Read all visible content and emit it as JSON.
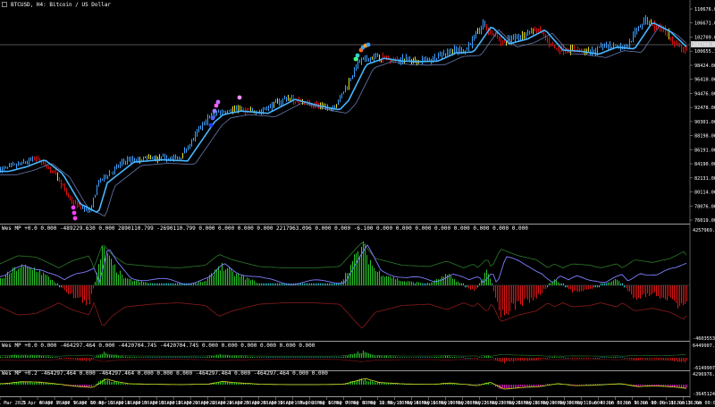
{
  "colors": {
    "background": "#000000",
    "bull": "#3fa0ff",
    "bear": "#e01010",
    "neutral": "#e8e020",
    "ma": "#49b6ff",
    "hist_up": "#28c828",
    "hist_down": "#e01515",
    "flat": "#20d0d0",
    "osc": "#7f7fff",
    "envelope_up": "#2b7a2b",
    "envelope_down": "#8a1b1b",
    "grid": "#7a7a7a",
    "divider": "#9a9a9a"
  },
  "main_panel": {
    "title": "BTCUSD, H4: Bitcoin / US Dollar",
    "price_axis": [
      "110676.00",
      "106671.00",
      "102709.00",
      "100655.14",
      "98424.00",
      "96410.00",
      "94476.00",
      "92478.00",
      "90301.00",
      "88198.00",
      "86191.00",
      "84190.00",
      "82131.00",
      "80114.00",
      "78076.00",
      "76019.00"
    ],
    "current_price_tag": "102709.00"
  },
  "indicator_1": {
    "header": "Wes MP +0.0 0.000 -489229.630 0.000 2890110.799 -2690110.799 0.000 0.000 0.000 0.000 2217963.096 0.000 0.000 -6.100 0.000 0.000 0.000 0.000 0.000 0.000 0.000 0.000",
    "scale_top": "4257969.444",
    "scale_bottom": "-4603553.424"
  },
  "indicator_2": {
    "header": "Wes MP +0.0 0.000 -464297.464 0.000 -4420704.745 -4420704.745 0.000 0.000 0.000 0.000 0.000 0.000",
    "scale_top": "6449907.794",
    "scale_bottom": "-6149907.794"
  },
  "indicator_3": {
    "header": "Wes MP +0.2 -464297.464 0.000 -464297.464 0.000 0.000 0.000 -464297.464 0.000 -464297.464 0.000 0.000",
    "scale_top": "4296976.706",
    "scale_bottom": "-3645124.573"
  },
  "time_axis": [
    "1 Mar 2025",
    "3 Apr 00:00",
    "4 Apr 08:00",
    "7 Apr 16:00",
    "9 Apr 00:00",
    "10 Apr 08:00",
    "11 Apr 16:00",
    "14 Apr 00:00",
    "15 Apr 08:00",
    "16 Apr 16:00",
    "18 Apr 00:00",
    "21 Apr 08:00",
    "22 Apr 16:00",
    "24 Apr 00:00",
    "25 Apr 08:00",
    "28 Apr 16:00",
    "30 Apr 00:00",
    "1 May 08:00",
    "2 May 16:00",
    "6 May 00:00",
    "7 May 08:00",
    "8 May 16:00",
    "12 May 00:00",
    "13 May 08:00",
    "14 May 16:00",
    "16 May 00:00",
    "19 May 08:00",
    "20 May 16:00",
    "22 May 00:00",
    "23 May 08:00",
    "26 May 16:00",
    "28 May 00:00",
    "29 May 08:00",
    "30 May 16:00",
    "3 Jun 00:00",
    "4 Jun 08:00",
    "5 Jun 16:00",
    "9 Jun 00:00",
    "10 Jun 08:00",
    "11 Jun 16:00",
    "13 Jun 00:00"
  ],
  "chart_data": [
    {
      "type": "line",
      "series": [
        {
          "name": "BTCUSD",
          "x": [
            0,
            20,
            40,
            60,
            80,
            100,
            110,
            140,
            170,
            200,
            230,
            240,
            260,
            290,
            320,
            350,
            370,
            380,
            400,
            420,
            440,
            460,
            480,
            500,
            520,
            540,
            560,
            580,
            600,
            620,
            640,
            660,
            680,
            700,
            720,
            740,
            760,
            770
          ],
          "values": [
            84000,
            84800,
            86000,
            83600,
            78400,
            76800,
            82000,
            85600,
            86000,
            85800,
            92500,
            93800,
            94400,
            94000,
            96400,
            95200,
            94600,
            96200,
            102400,
            103500,
            103000,
            102900,
            103000,
            104400,
            104600,
            109000,
            106000,
            106800,
            108400,
            104900,
            104700,
            104200,
            105400,
            105100,
            109700,
            108100,
            105200,
            104700
          ]
        }
      ],
      "ylim": [
        75000,
        112000
      ]
    },
    {
      "type": "bar",
      "series": [
        {
          "name": "histogram",
          "x": [
            0,
            20,
            40,
            60,
            80,
            100,
            115,
            125,
            140,
            170,
            200,
            230,
            245,
            260,
            290,
            320,
            350,
            380,
            405,
            420,
            450,
            480,
            500,
            530,
            545,
            560,
            580,
            600,
            620,
            640,
            660,
            690,
            710,
            730,
            750,
            765,
            780
          ],
          "values": [
            0.3,
            0.9,
            0.8,
            0.2,
            -0.5,
            -0.9,
            1.8,
            1.0,
            0.3,
            0.1,
            0.0,
            0.2,
            1.0,
            0.6,
            0.1,
            0.0,
            0.0,
            0.1,
            1.9,
            0.7,
            0.2,
            0.1,
            0.5,
            -0.3,
            0.7,
            -1.4,
            -0.9,
            -0.6,
            0.3,
            -0.3,
            -0.2,
            0.3,
            -0.6,
            -0.4,
            -0.7,
            -1.2,
            0.1
          ]
        }
      ],
      "ylim": [
        -2.5,
        2.5
      ]
    }
  ]
}
